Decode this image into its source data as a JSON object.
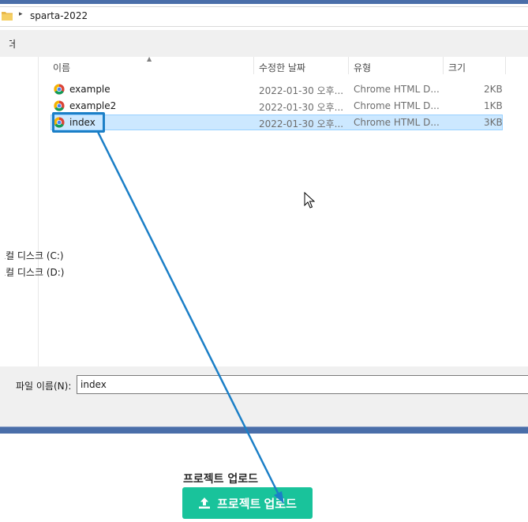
{
  "address_bar": {
    "path": "sparta-2022"
  },
  "toolbar": {
    "text": "폴더"
  },
  "nav": {
    "drives": [
      "로컬 디스크 (C:)",
      "로컬 디스크 (D:)"
    ]
  },
  "columns": {
    "name": "이름",
    "date": "수정한 날짜",
    "type": "유형",
    "size": "크기"
  },
  "files": [
    {
      "name": "example",
      "date": "2022-01-30 오후...",
      "type": "Chrome HTML D...",
      "size": "2KB",
      "selected": false
    },
    {
      "name": "example2",
      "date": "2022-01-30 오후...",
      "type": "Chrome HTML D...",
      "size": "1KB",
      "selected": false
    },
    {
      "name": "index",
      "date": "2022-01-30 오후...",
      "type": "Chrome HTML D...",
      "size": "3KB",
      "selected": true
    }
  ],
  "filename": {
    "label": "파일 이름(N):",
    "value": "index"
  },
  "page": {
    "heading": "프로젝트 업로드",
    "button_label": "프로젝트 업로드"
  },
  "colors": {
    "accent": "#19c39b",
    "highlight": "#1b7fc7",
    "selection": "#cce8ff"
  }
}
